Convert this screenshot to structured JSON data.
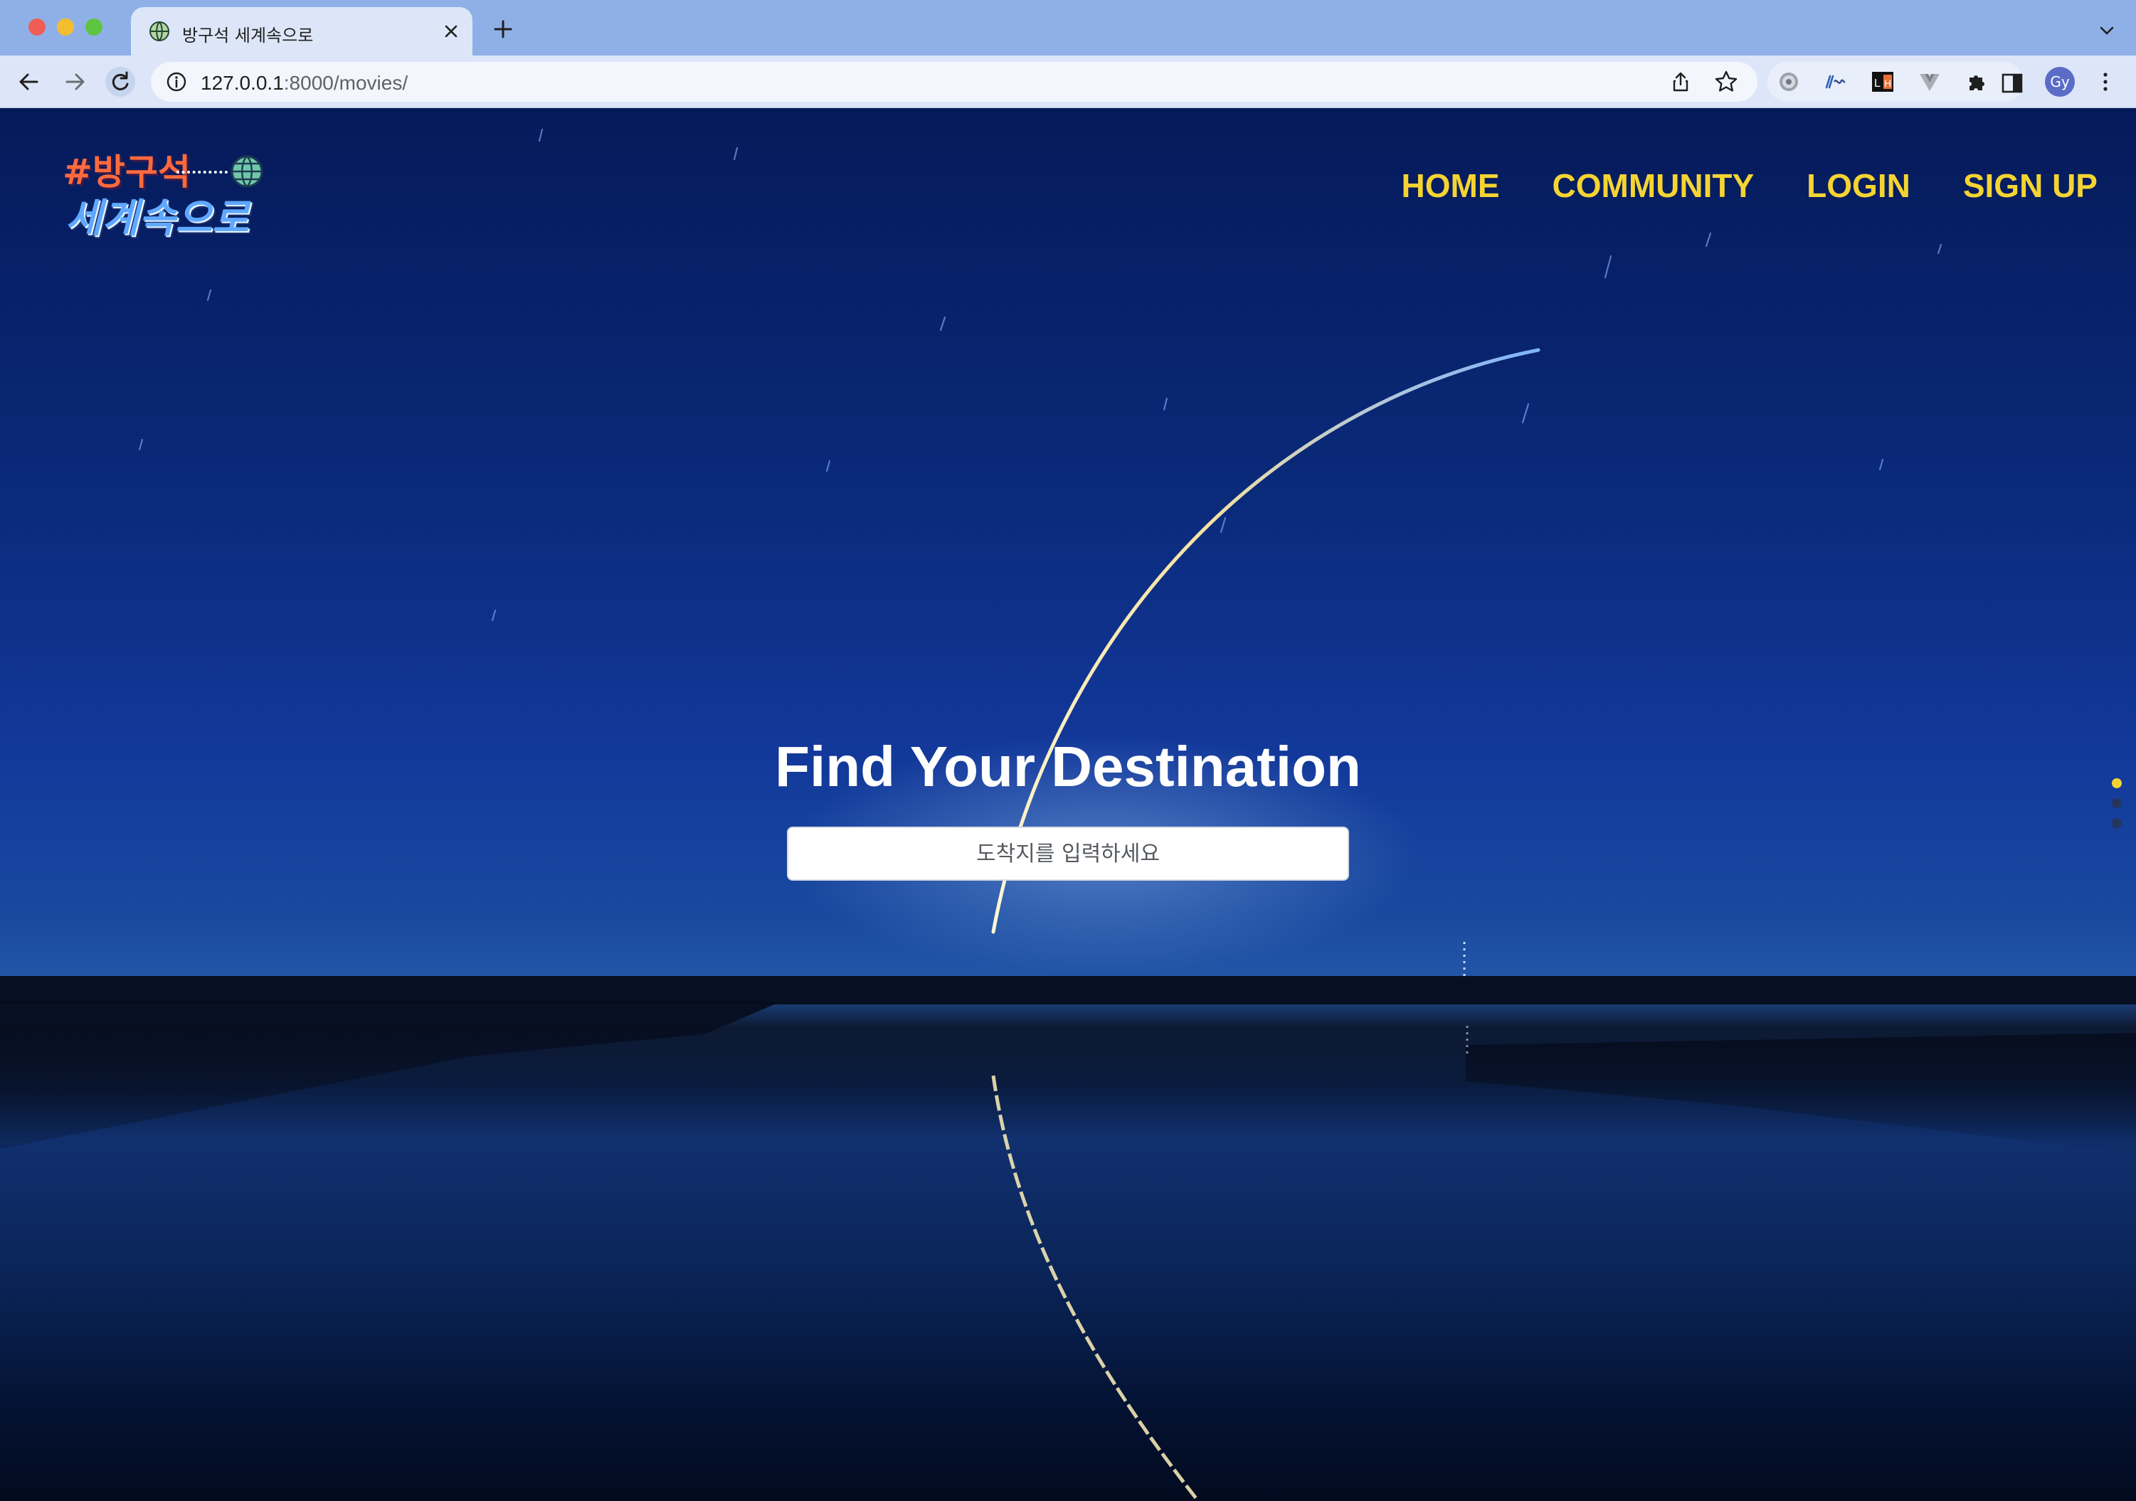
{
  "browser": {
    "tab": {
      "title": "방구석 세계속으로",
      "favicon": "globe-favicon-icon"
    },
    "url": {
      "host": "127.0.0.1",
      "path": ":8000/movies/"
    },
    "profile_initials": "Gy",
    "extensions": [
      "settings-ext-icon",
      "wave-ext-icon",
      "lh-ext-icon",
      "vue-ext-icon",
      "puzzle-icon"
    ]
  },
  "site": {
    "logo": {
      "line1": "#방구석",
      "line2": "세계속으로"
    },
    "nav": [
      {
        "label": "HOME"
      },
      {
        "label": "COMMUNITY"
      },
      {
        "label": "LOGIN"
      },
      {
        "label": "SIGN UP"
      }
    ],
    "hero": {
      "title": "Find Your Destination",
      "search_placeholder": "도착지를 입력하세요"
    },
    "pagination": {
      "count": 3,
      "active_index": 0
    }
  },
  "colors": {
    "nav_accent": "#f5d432",
    "hero_text": "#ffffff",
    "titlebar": "#8fb0e7",
    "toolbar": "#dce6f8"
  }
}
